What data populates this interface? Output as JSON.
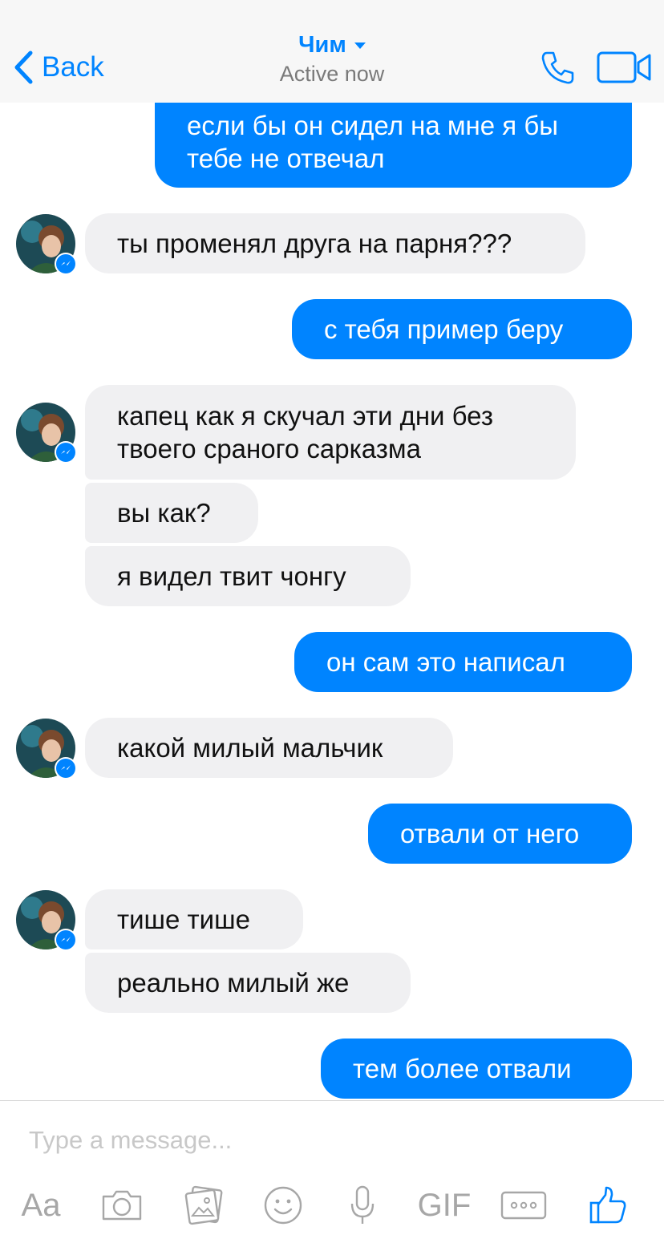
{
  "header": {
    "back_label": "Back",
    "contact_name": "Чим",
    "status": "Active now",
    "accent": "#0084ff"
  },
  "messages": [
    {
      "from": "me",
      "text": "если бы он сидел на мне я бы тебе не отвечал"
    },
    {
      "from": "contact",
      "text": "ты променял друга на парня???"
    },
    {
      "from": "me",
      "text": "с тебя пример беру"
    },
    {
      "from": "contact",
      "text": "капец как я скучал эти дни без твоего сраного сарказма"
    },
    {
      "from": "contact",
      "text": "вы как?"
    },
    {
      "from": "contact",
      "text": "я видел твит чонгу"
    },
    {
      "from": "me",
      "text": "он сам это написал"
    },
    {
      "from": "contact",
      "text": "какой милый мальчик"
    },
    {
      "from": "me",
      "text": "отвали от него"
    },
    {
      "from": "contact",
      "text": "тише тише"
    },
    {
      "from": "contact",
      "text": "реально милый же"
    },
    {
      "from": "me",
      "text": "тем более отвали"
    }
  ],
  "composer": {
    "placeholder": "Type a message...",
    "text_tool_label": "Aa",
    "gif_label": "GIF",
    "icons": [
      "camera-icon",
      "photo-icon",
      "emoji-icon",
      "microphone-icon",
      "more-icon",
      "thumbs-up-icon"
    ]
  },
  "colors": {
    "outgoing_bubble": "#0084ff",
    "incoming_bubble": "#f0f0f2",
    "header_bg": "#f7f7f7"
  }
}
